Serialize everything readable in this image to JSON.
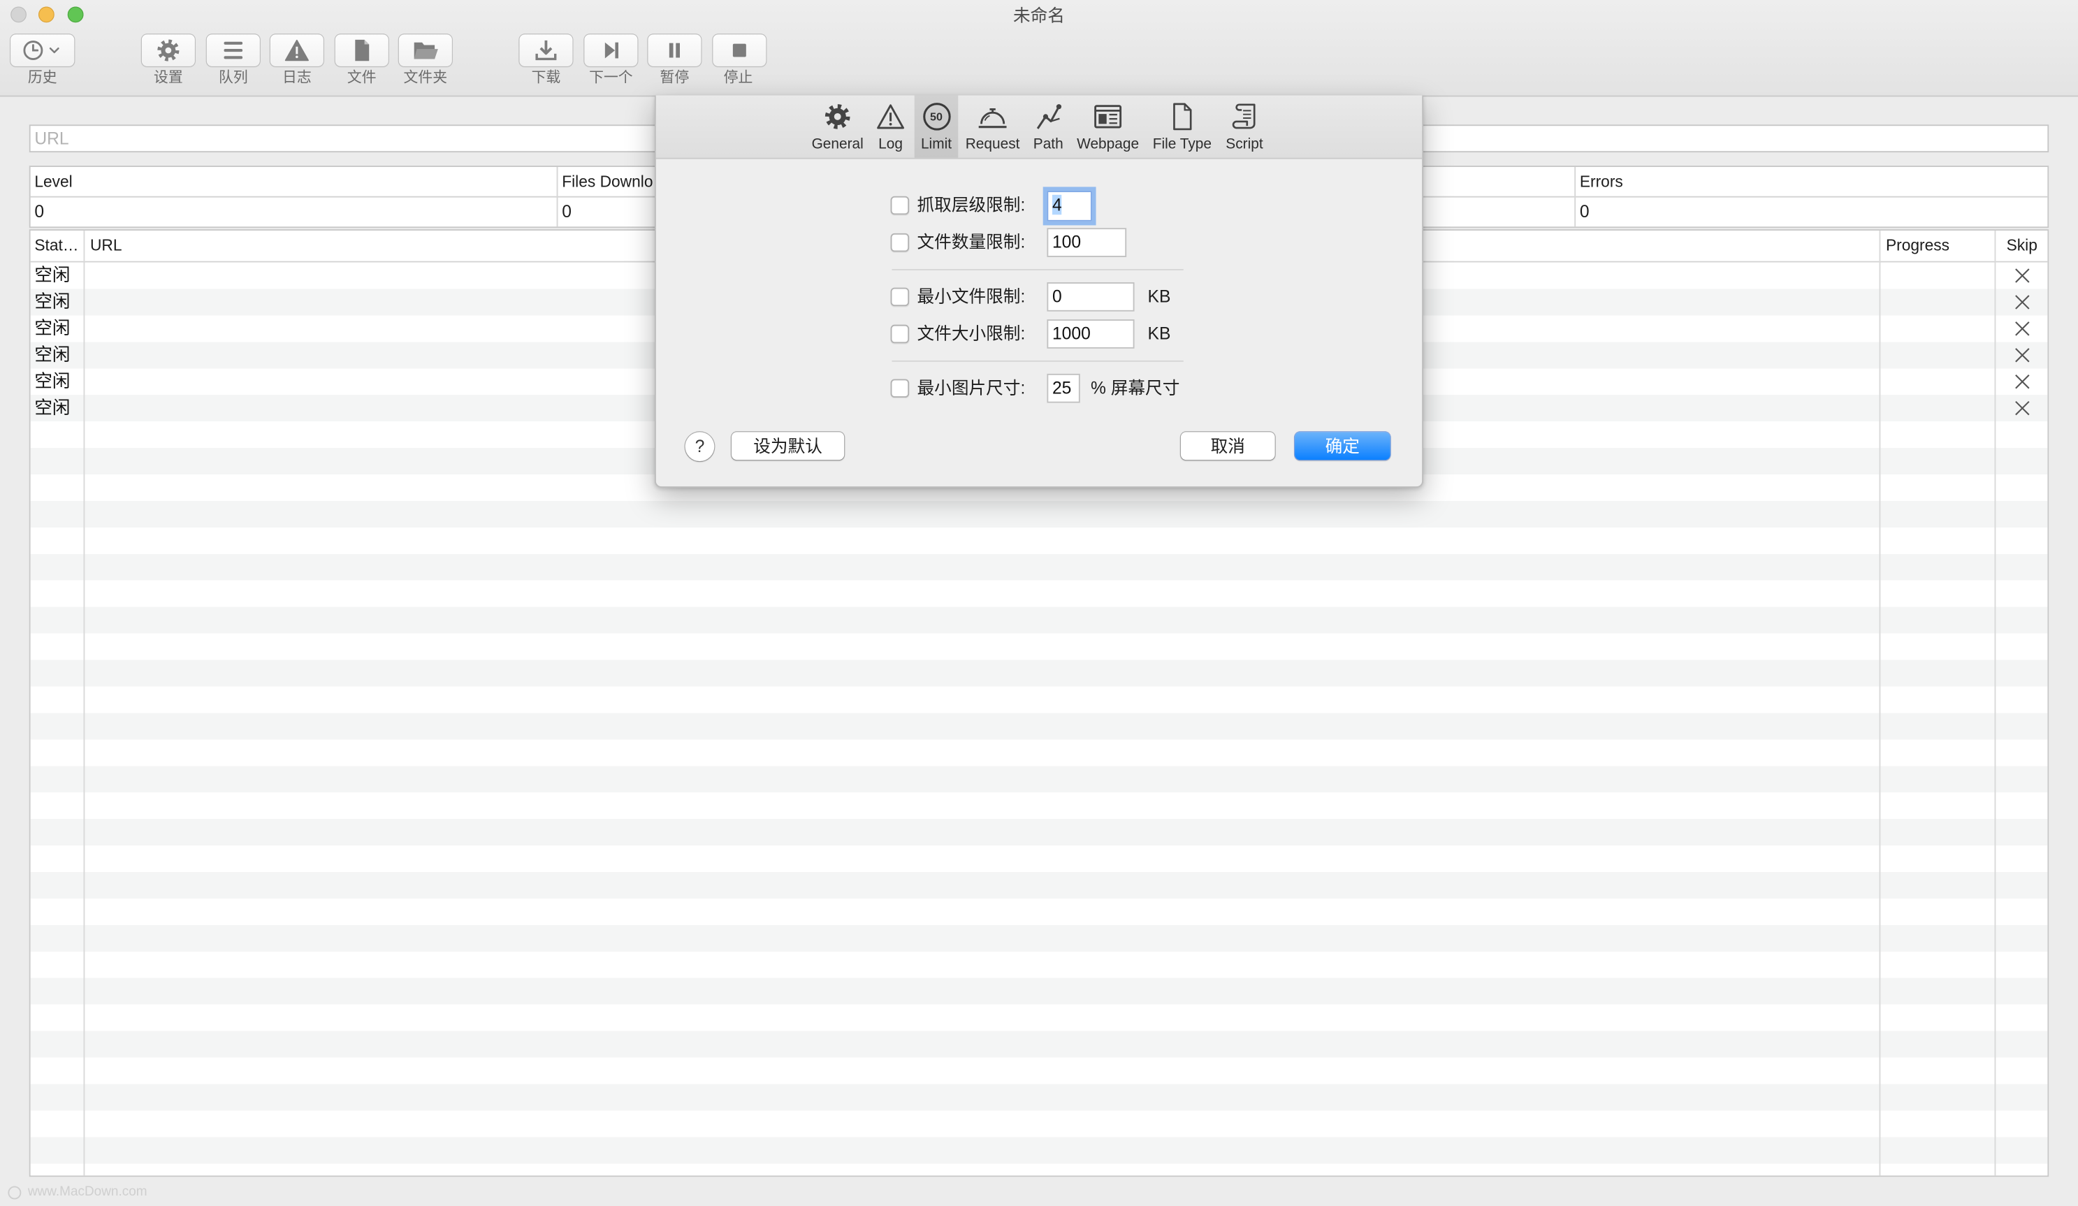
{
  "window": {
    "title": "未命名"
  },
  "toolbar": {
    "history": {
      "label": "历史",
      "icon": "clock-icon"
    },
    "settings": {
      "label": "设置",
      "icon": "gear-icon"
    },
    "queue": {
      "label": "队列",
      "icon": "list-icon"
    },
    "log": {
      "label": "日志",
      "icon": "warning-icon"
    },
    "file": {
      "label": "文件",
      "icon": "document-icon"
    },
    "folder": {
      "label": "文件夹",
      "icon": "folder-icon"
    },
    "download": {
      "label": "下载",
      "icon": "download-icon"
    },
    "next": {
      "label": "下一个",
      "icon": "next-icon"
    },
    "pause": {
      "label": "暂停",
      "icon": "pause-icon"
    },
    "stop": {
      "label": "停止",
      "icon": "stop-icon"
    }
  },
  "url_field": {
    "placeholder": "URL"
  },
  "stats": {
    "headers": {
      "level": "Level",
      "files_downloaded": "Files Downlo",
      "errors": "Errors"
    },
    "values": {
      "level": "0",
      "files_downloaded": "0",
      "errors": "0"
    }
  },
  "queue_table": {
    "headers": {
      "status": "Stat…",
      "url": "URL",
      "progress": "Progress",
      "skip": "Skip"
    },
    "rows": [
      {
        "status": "空闲",
        "skip_icon": "close-icon"
      },
      {
        "status": "空闲",
        "skip_icon": "close-icon"
      },
      {
        "status": "空闲",
        "skip_icon": "close-icon"
      },
      {
        "status": "空闲",
        "skip_icon": "close-icon"
      },
      {
        "status": "空闲",
        "skip_icon": "close-icon"
      },
      {
        "status": "空闲",
        "skip_icon": "close-icon"
      }
    ]
  },
  "preferences_sheet": {
    "tabs": [
      {
        "label": "General",
        "icon": "gear-icon"
      },
      {
        "label": "Log",
        "icon": "warning-icon"
      },
      {
        "label": "Limit",
        "icon": "limit-icon",
        "badge": "50"
      },
      {
        "label": "Request",
        "icon": "bell-icon"
      },
      {
        "label": "Path",
        "icon": "path-icon"
      },
      {
        "label": "Webpage",
        "icon": "webpage-icon"
      },
      {
        "label": "File Type",
        "icon": "file-type-icon"
      },
      {
        "label": "Script",
        "icon": "script-icon"
      }
    ],
    "selected_tab_index": 2,
    "limits": {
      "crawl_depth": {
        "label": "抓取层级限制:",
        "value": "4",
        "checked": false
      },
      "file_count": {
        "label": "文件数量限制:",
        "value": "100",
        "checked": false
      },
      "min_file_size": {
        "label": "最小文件限制:",
        "value": "0",
        "unit": "KB",
        "checked": false
      },
      "max_file_size": {
        "label": "文件大小限制:",
        "value": "1000",
        "unit": "KB",
        "checked": false
      },
      "min_image_size": {
        "label": "最小图片尺寸:",
        "value": "25",
        "unit": "% 屏幕尺寸",
        "checked": false
      }
    },
    "buttons": {
      "help": "?",
      "set_default": "设为默认",
      "cancel": "取消",
      "ok": "确定"
    }
  },
  "watermark": "www.MacDown.com",
  "colors": {
    "accent": "#3b8ef5",
    "selection": "#b3d7ff",
    "focus_ring": "#7ea8e6",
    "row_stripe": "#f4f5f5",
    "traffic_close_disabled": "#d4d4d4",
    "traffic_minimize": "#f6be4f",
    "traffic_zoom": "#61c554"
  }
}
